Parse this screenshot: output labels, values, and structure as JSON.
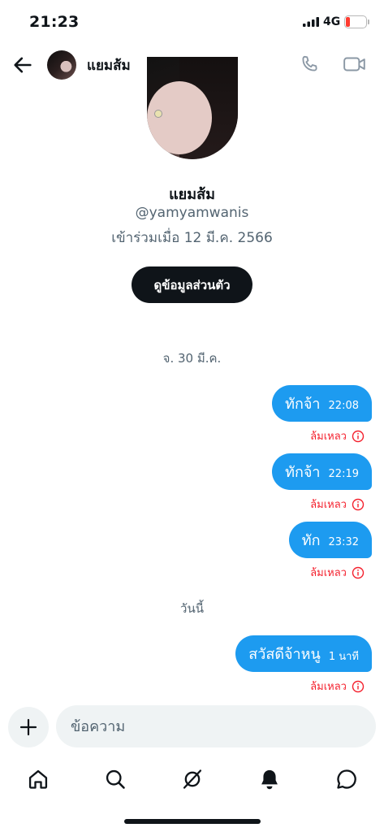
{
  "status_bar": {
    "time": "21:23",
    "network": "4G",
    "battery": "11",
    "battery_level": 0.11
  },
  "header": {
    "name": "แยมส้ม"
  },
  "profile": {
    "name": "แยมส้ม",
    "handle": "@yamyamwanis",
    "joined": "เข้าร่วมเมื่อ 12 มี.ค. 2566",
    "view_profile_label": "ดูข้อมูลส่วนตัว"
  },
  "date_separators": [
    "จ. 30 มี.ค.",
    "วันนี้"
  ],
  "messages": [
    {
      "text": "ทักจ้า",
      "time": "22:08",
      "status": "ล้มเหลว"
    },
    {
      "text": "ทักจ้า",
      "time": "22:19",
      "status": "ล้มเหลว"
    },
    {
      "text": "ทัก",
      "time": "23:32",
      "status": "ล้มเหลว"
    },
    {
      "text": "สวัสดีจ้าหนู",
      "time": "1 นาที",
      "status": "ล้มเหลว"
    }
  ],
  "composer": {
    "placeholder": "ข้อความ"
  },
  "tabs": [
    "home",
    "search",
    "communities",
    "notifications",
    "messages"
  ],
  "colors": {
    "accent": "#1d9bf0",
    "error": "#f4212e",
    "secondary_text": "#536471"
  }
}
